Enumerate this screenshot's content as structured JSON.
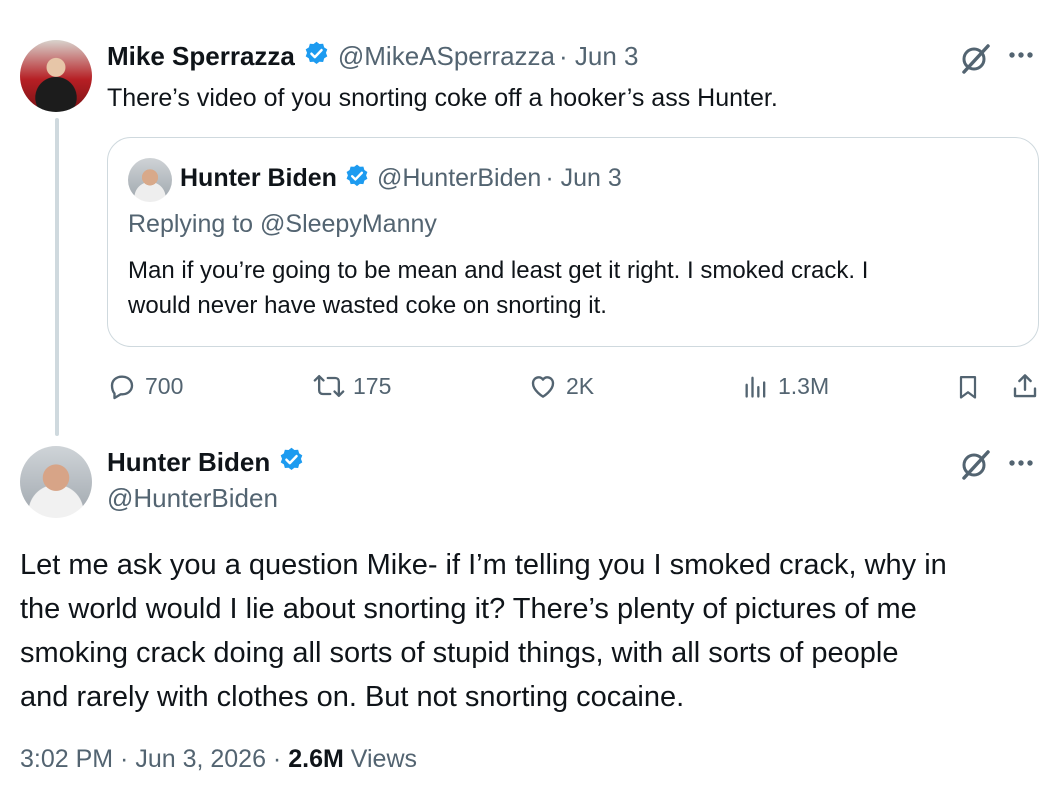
{
  "tweet1": {
    "author_name": "Mike Sperrazza",
    "handle": "@MikeASperrazza",
    "date": "· Jun 3",
    "text": "There’s video of you snorting coke off a hooker’s ass Hunter.",
    "quote": {
      "author_name": "Hunter Biden",
      "handle": "@HunterBiden",
      "date": "· Jun 3",
      "replying_to": "Replying to @SleepyManny",
      "text_line1": "Man if you’re going to be mean and least get it right. I smoked crack. I",
      "text_line2": "would never have wasted coke on snorting it."
    },
    "actions": {
      "replies": "700",
      "reposts": "175",
      "likes": "2K",
      "views": "1.3M"
    }
  },
  "tweet2": {
    "author_name": "Hunter Biden",
    "handle": "@HunterBiden",
    "lines": [
      "Let me ask you a question Mike- if I’m telling you I smoked crack, why in",
      "the world would I lie about snorting it? There’s plenty of pictures of me",
      "smoking crack doing all sorts of stupid things, with all sorts of people",
      "and rarely with clothes on. But not snorting cocaine."
    ],
    "timestamp": "3:02 PM · Jun 3, 2026 ·",
    "views_count": "2.6M",
    "views_label": "Views"
  },
  "colors": {
    "verified_blue": "#1d9bf0",
    "muted": "#536471",
    "border": "#cfd9de"
  },
  "icons": [
    "verified-icon",
    "grok-icon",
    "more-icon",
    "reply-icon",
    "repost-icon",
    "like-icon",
    "views-icon",
    "bookmark-icon",
    "share-icon"
  ]
}
